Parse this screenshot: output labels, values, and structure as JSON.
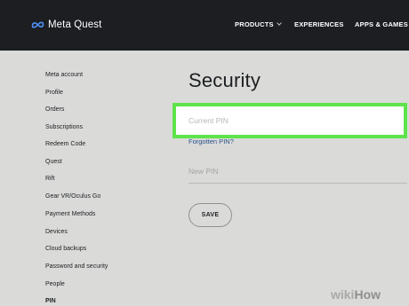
{
  "header": {
    "logo_text": "Meta Quest",
    "nav": [
      {
        "label": "PRODUCTS"
      },
      {
        "label": "EXPERIENCES"
      },
      {
        "label": "APPS & GAMES"
      }
    ]
  },
  "sidebar": {
    "items": [
      {
        "label": "Meta account"
      },
      {
        "label": "Profile"
      },
      {
        "label": "Orders"
      },
      {
        "label": "Subscriptions"
      },
      {
        "label": "Redeem Code"
      },
      {
        "label": "Quest"
      },
      {
        "label": "Rift"
      },
      {
        "label": "Gear VR/Oculus Go"
      },
      {
        "label": "Payment Methods"
      },
      {
        "label": "Devices"
      },
      {
        "label": "Cloud backups"
      },
      {
        "label": "Password and security"
      },
      {
        "label": "People"
      },
      {
        "label": "PIN"
      }
    ],
    "active": "PIN"
  },
  "main": {
    "title": "Security",
    "current_pin_placeholder": "Current PIN",
    "forgot_link": "Forgotten PIN?",
    "new_pin_placeholder": "New PIN",
    "save_label": "SAVE"
  },
  "highlight_color": "#5ee34b",
  "watermark": {
    "part1": "wiki",
    "part2": "How"
  }
}
